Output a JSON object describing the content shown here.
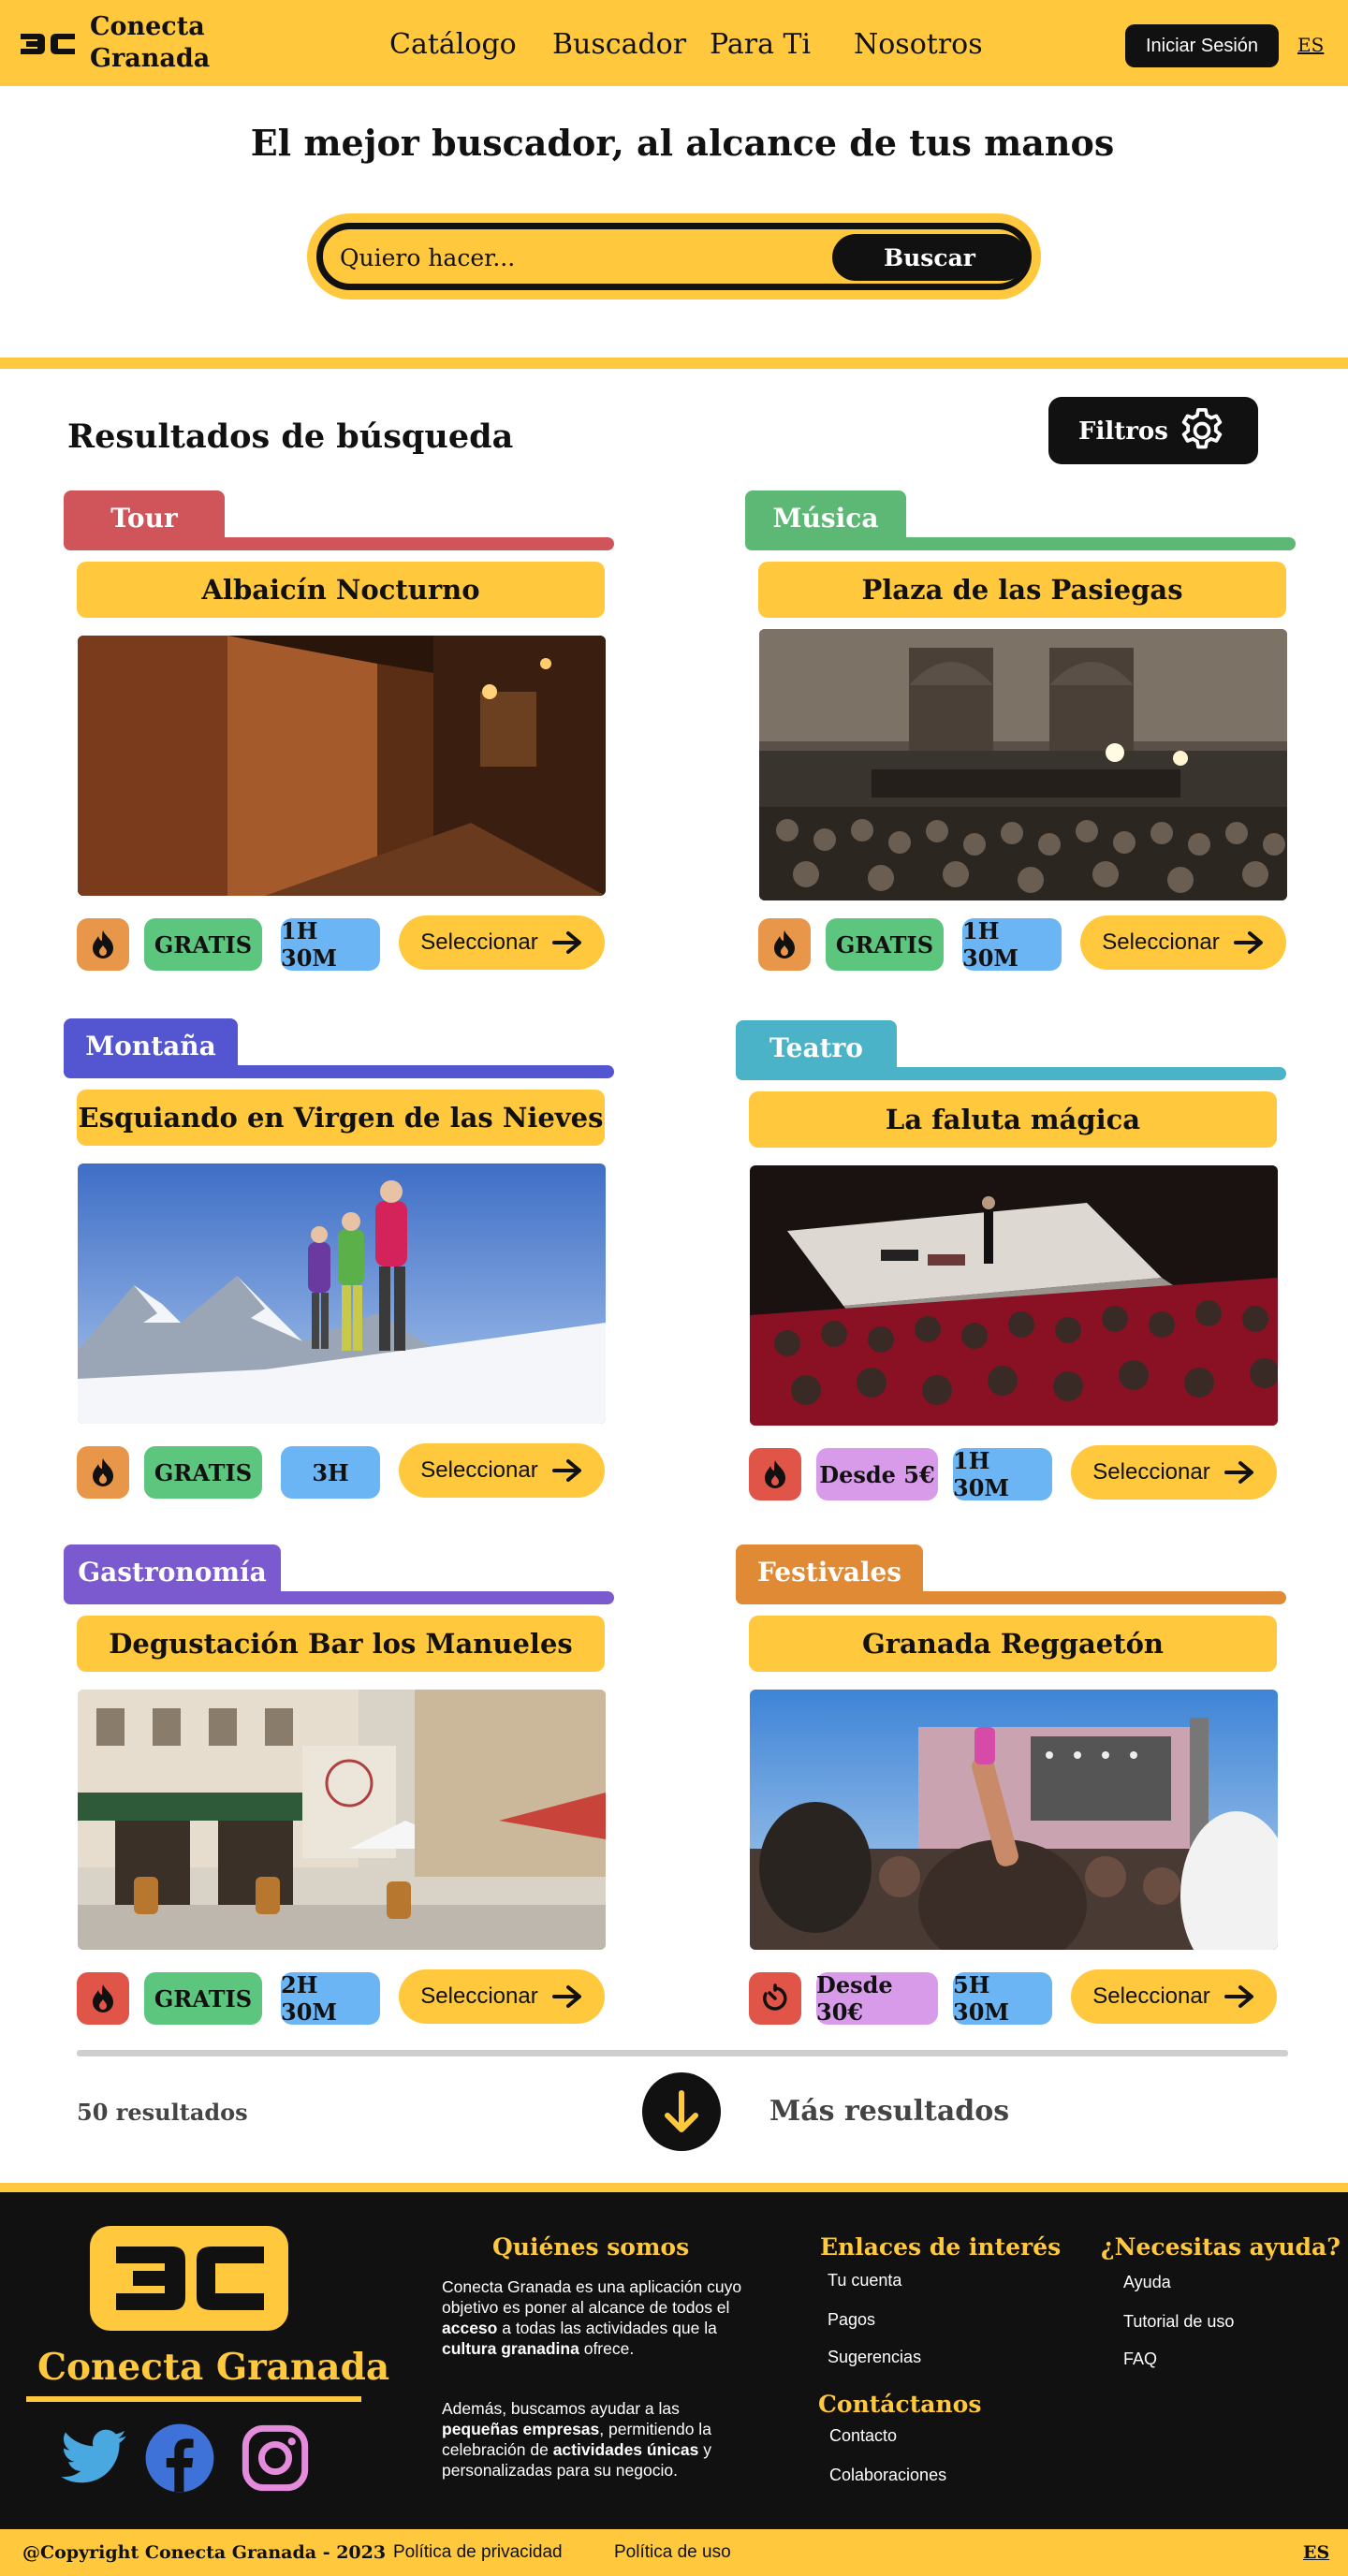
{
  "colors": {
    "brand_yellow": "#FFC83D",
    "dark": "#111111",
    "time_tag_blue": "#6BB5F5",
    "free_tag_green": "#5CC67E",
    "paid_tag_purple": "#D89BEA"
  },
  "header": {
    "brand_line1": "Conecta",
    "brand_line2": "Granada",
    "nav": [
      "Catálogo",
      "Buscador",
      "Para Ti",
      "Nosotros"
    ],
    "login_label": "Iniciar Sesión",
    "language": "ES"
  },
  "hero": {
    "title": "El mejor buscador, al alcance de tus manos",
    "search_placeholder": "Quiero hacer...",
    "search_button": "Buscar"
  },
  "results": {
    "title": "Resultados de búsqueda",
    "filters_label": "Filtros",
    "select_label": "Seleccionar",
    "count_label": "50 resultados",
    "more_label": "Más resultados",
    "cards": [
      {
        "category": "Tour",
        "category_color": "#D0555A",
        "title": "Albaicín Nocturno",
        "icon": "flame-icon",
        "icon_bg": "#E8974A",
        "price": "GRATIS",
        "price_color": "#5CC67E",
        "duration": "1H 30M"
      },
      {
        "category": "Música",
        "category_color": "#5CB874",
        "title": "Plaza de las Pasiegas",
        "icon": "flame-icon",
        "icon_bg": "#E8974A",
        "price": "GRATIS",
        "price_color": "#5CC67E",
        "duration": "1H 30M"
      },
      {
        "category": "Montaña",
        "category_color": "#5455D0",
        "title": "Esquiando en Virgen de las Nieves",
        "icon": "flame-icon",
        "icon_bg": "#E8974A",
        "price": "GRATIS",
        "price_color": "#5CC67E",
        "duration": "3H"
      },
      {
        "category": "Teatro",
        "category_color": "#4BB3C8",
        "title": "La faluta mágica",
        "icon": "flame-icon",
        "icon_bg": "#E05548",
        "price": "Desde 5€",
        "price_color": "#D89BEA",
        "duration": "1H 30M"
      },
      {
        "category": "Gastronomía",
        "category_color": "#7B5AD0",
        "title": "Degustación Bar los Manueles",
        "icon": "flame-icon",
        "icon_bg": "#E05548",
        "price": "GRATIS",
        "price_color": "#5CC67E",
        "duration": "2H 30M"
      },
      {
        "category": "Festivales",
        "category_color": "#E08A35",
        "title": "Granada Reggaetón",
        "icon": "timer-icon",
        "icon_bg": "#E05548",
        "price": "Desde 30€",
        "price_color": "#D89BEA",
        "duration": "5H 30M"
      }
    ]
  },
  "footer": {
    "brand": "Conecta Granada",
    "about_title": "Quiénes somos",
    "about_p1_a": "Conecta Granada es una aplicación cuyo objetivo es poner al alcance de todos el ",
    "about_p1_b": "acceso",
    "about_p1_c": " a todas las actividades que la ",
    "about_p1_d": "cultura granadina",
    "about_p1_e": " ofrece.",
    "about_p2_a": "Además, buscamos ayudar a las ",
    "about_p2_b": "pequeñas empresas",
    "about_p2_c": ", permitiendo la celebración de ",
    "about_p2_d": "actividades únicas",
    "about_p2_e": " y personalizadas para su negocio.",
    "links_title": "Enlaces de interés",
    "links": [
      "Tu cuenta",
      "Pagos",
      "Sugerencias"
    ],
    "contact_title": "Contáctanos",
    "contact_links": [
      "Contacto",
      "Colaboraciones"
    ],
    "help_title": "¿Necesitas ayuda?",
    "help_links": [
      "Ayuda",
      "Tutorial de uso",
      "FAQ"
    ],
    "copyright": "@Copyright Conecta Granada - 2023",
    "privacy": "Política de privacidad",
    "terms": "Política de uso",
    "language": "ES"
  }
}
